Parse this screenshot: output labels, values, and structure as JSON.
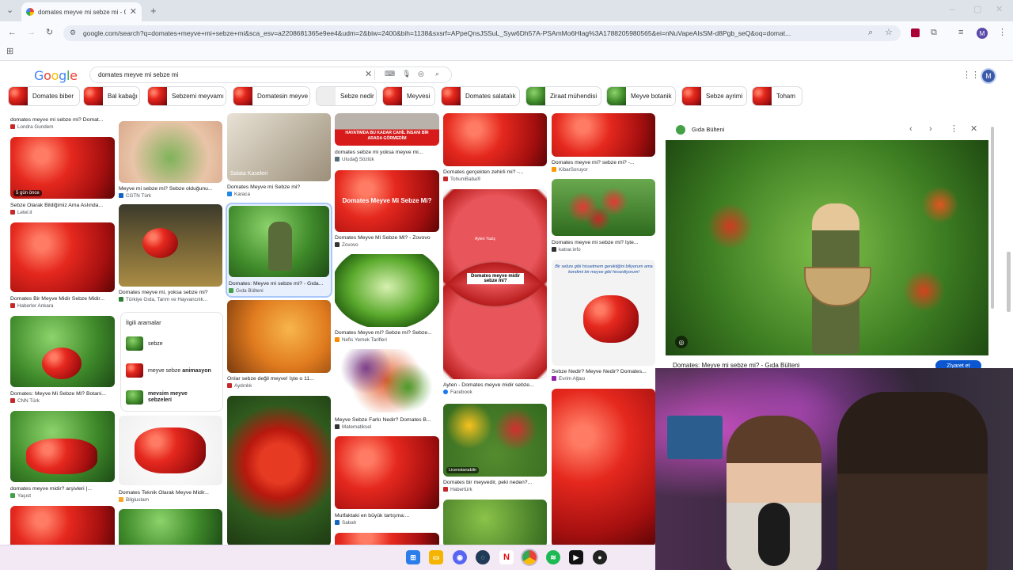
{
  "browser": {
    "tab_title": "domates meyve mi sebze mi - G",
    "url": "google.com/search?q=domates+meyve+mi+sebze+mi&sca_esv=a2208681365e9ee4&udm=2&biw=2400&bih=1138&sxsrf=APpeQnsJSSuL_Syw6Dh57A-PSAmMo6HIag%3A1788205980565&ei=nNuVapeAIsSM-d8Pgb_seQ&oq=domat...",
    "profile_initial": "M"
  },
  "google": {
    "logo": [
      "G",
      "o",
      "o",
      "g",
      "l",
      "e"
    ],
    "query": "domates meyve mi sebze mi",
    "avatar": "M"
  },
  "chips": [
    {
      "label": "Domates biber"
    },
    {
      "label": "Bal kabağı"
    },
    {
      "label": "Sebzemi meyvamı"
    },
    {
      "label": "Domatesin meyve"
    },
    {
      "label": "Sebze nedir"
    },
    {
      "label": "Meyvesi"
    },
    {
      "label": "Domates salatalık"
    },
    {
      "label": "Ziraat mühendisi"
    },
    {
      "label": "Meyve botanik"
    },
    {
      "label": "Sebze ayrimi"
    },
    {
      "label": "Toham"
    }
  ],
  "grid": {
    "c1": [
      {
        "cap": "domates meyve mi sebze mi? Domat...",
        "src": "Londra Gundem"
      },
      {
        "cap": "Sebze Olarak Bildiğimiz Ama Aslında...",
        "src": "Letel.it",
        "badge": "5 gün önce"
      },
      {
        "cap": "Domates Bir Meyve Midir Sebze Midir...",
        "src": "Haberler Ankara"
      },
      {
        "cap": "Domates: Meyve Mi Sebze Mi? Botani...",
        "src": "CNN Türk"
      },
      {
        "cap": "domates meyve midir? arşivleri |...",
        "src": "Yaşıst"
      }
    ],
    "c2": [
      {
        "cap": "Meyve mi sebze mi? Sebze olduğunu...",
        "src": "CGTN Türk"
      },
      {
        "cap": "Domates meyve mi, yoksa sebze mi?",
        "src": "Türkiye Gıda, Tarım ve Hayvancılık..."
      },
      {
        "cap": "Domates Teknik Olarak Meyve Midir...",
        "src": "Bilgiustam"
      }
    ],
    "c3": [
      {
        "cap": "Domates Meyve mi Sebze mi?",
        "src": "Karaca",
        "overlay": "Salata Kaseleri"
      },
      {
        "cap": "Domates: Meyve mi sebze mi? - Gıda...",
        "src": "Gıda Bülteni"
      },
      {
        "cap": "Onlar sebze değil meyve! İşte o 11...",
        "src": "Aydınlık"
      }
    ],
    "c4": [
      {
        "cap": "domates sebze mi yoksa meyve mi...",
        "src": "Uludağ Sözlük",
        "banner": "HAYATIMDA BU KADAR CAHİL İNSANI BİR ARADA GÖRMEDİM"
      },
      {
        "cap": "Domates Meyve Mi Sebze Mi? - Zovovo",
        "src": "Zovovo",
        "overlay": "Domates Meyve Mi Sebze Mi?"
      },
      {
        "cap": "Domates Meyve mi? Sebze mi? Sebze...",
        "src": "Nefis Yemek Tarifleri"
      },
      {
        "cap": "Meyve Sebze Farkı Nedir? Domates B...",
        "src": "Matematiksel"
      },
      {
        "cap": "Mutfaktaki en büyük tartışma:...",
        "src": "Sabah"
      }
    ],
    "c5": [
      {
        "cap": "Domates gerçekten zehirli mi? -...",
        "src": "TohumBaba®"
      },
      {
        "cap": "Ayten - Domates meyve midir sebze...",
        "src": "Facebook",
        "label": "Domates meyve midir sebze mi?",
        "tag": "Ayten Yaziş"
      },
      {
        "cap": "Domates bir meyvedir, peki neden?...",
        "src": "Habertürk",
        "tag": "Licenstanabilir"
      }
    ],
    "c6": [
      {
        "cap": "Domates meyve mi? sebze mi? -...",
        "src": "KibarSoruyor"
      },
      {
        "cap": "Domates meyve mi sebze mi? İşte...",
        "src": "katrar.info"
      },
      {
        "cap": "Sebze Nedir? Meyve Nedir? Domates...",
        "src": "Evrim Ağacı",
        "quote": "Bir sebze gibi hissetmem gerektiğini biliyorum ama kendimi bir meyve gibi hissediyorum!"
      }
    ]
  },
  "related": {
    "title": "İlgili aramalar",
    "items": [
      {
        "label": "sebze",
        "bold": ""
      },
      {
        "label": "meyve sebze ",
        "bold": "animasyon"
      },
      {
        "label": "",
        "bold": "mevsim meyve sebzeleri"
      }
    ]
  },
  "panel": {
    "source": "Gıda Bülteni",
    "title": "Domates: Meyve mi sebze mi? - Gıda Bülteni",
    "visit": "Ziyaret et"
  }
}
